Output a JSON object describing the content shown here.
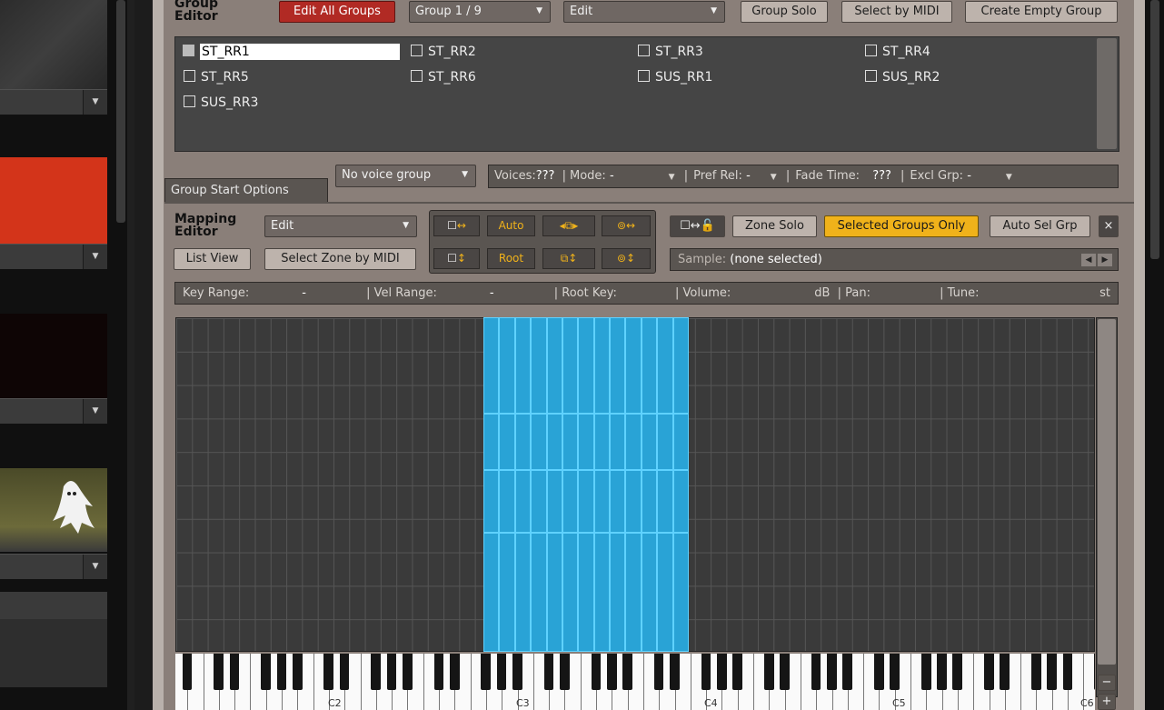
{
  "group_editor": {
    "label": "Group\nEditor",
    "edit_all_groups": "Edit All Groups",
    "group_select": "Group 1 / 9",
    "edit_mode": "Edit",
    "group_solo": "Group Solo",
    "select_by_midi": "Select by MIDI",
    "create_empty_group": "Create Empty Group",
    "groups": [
      "ST_RR1",
      "ST_RR2",
      "ST_RR3",
      "ST_RR4",
      "ST_RR5",
      "ST_RR6",
      "SUS_RR1",
      "SUS_RR2",
      "SUS_RR3"
    ]
  },
  "group_start_options": {
    "tab": "Group Start Options",
    "voice_group": "No voice group",
    "voices_label": "Voices:",
    "voices_value": "???",
    "mode_label": "Mode:",
    "mode_value": "-",
    "pref_rel_label": "Pref Rel:",
    "pref_rel_value": "-",
    "fade_time_label": "Fade Time:",
    "fade_time_value": "???",
    "excl_grp_label": "Excl Grp:",
    "excl_grp_value": "-"
  },
  "mapping_editor": {
    "label": "Mapping\nEditor",
    "edit_mode": "Edit",
    "list_view": "List View",
    "select_zone_by_midi": "Select Zone by MIDI",
    "auto": "Auto",
    "root": "Root",
    "zone_solo": "Zone Solo",
    "selected_groups_only": "Selected Groups Only",
    "auto_sel_grp": "Auto Sel Grp",
    "close": "×",
    "sample_label": "Sample:",
    "sample_value": "(none selected)",
    "info": {
      "key_range_label": "Key Range:",
      "key_range": "-",
      "vel_range_label": "Vel Range:",
      "vel_range": "-",
      "root_key_label": "Root Key:",
      "volume_label": "Volume:",
      "volume_unit": "dB",
      "pan_label": "Pan:",
      "tune_label": "Tune:",
      "tune_unit": "st"
    }
  },
  "keyboard": {
    "octave_labels": [
      "C2",
      "C3",
      "C4",
      "C5",
      "C6"
    ],
    "zoom_minus": "−",
    "zoom_plus": "+"
  },
  "colors": {
    "accent_yellow": "#f0b21a",
    "edit_red": "#b12a24",
    "zone_blue": "#29a3d6"
  }
}
